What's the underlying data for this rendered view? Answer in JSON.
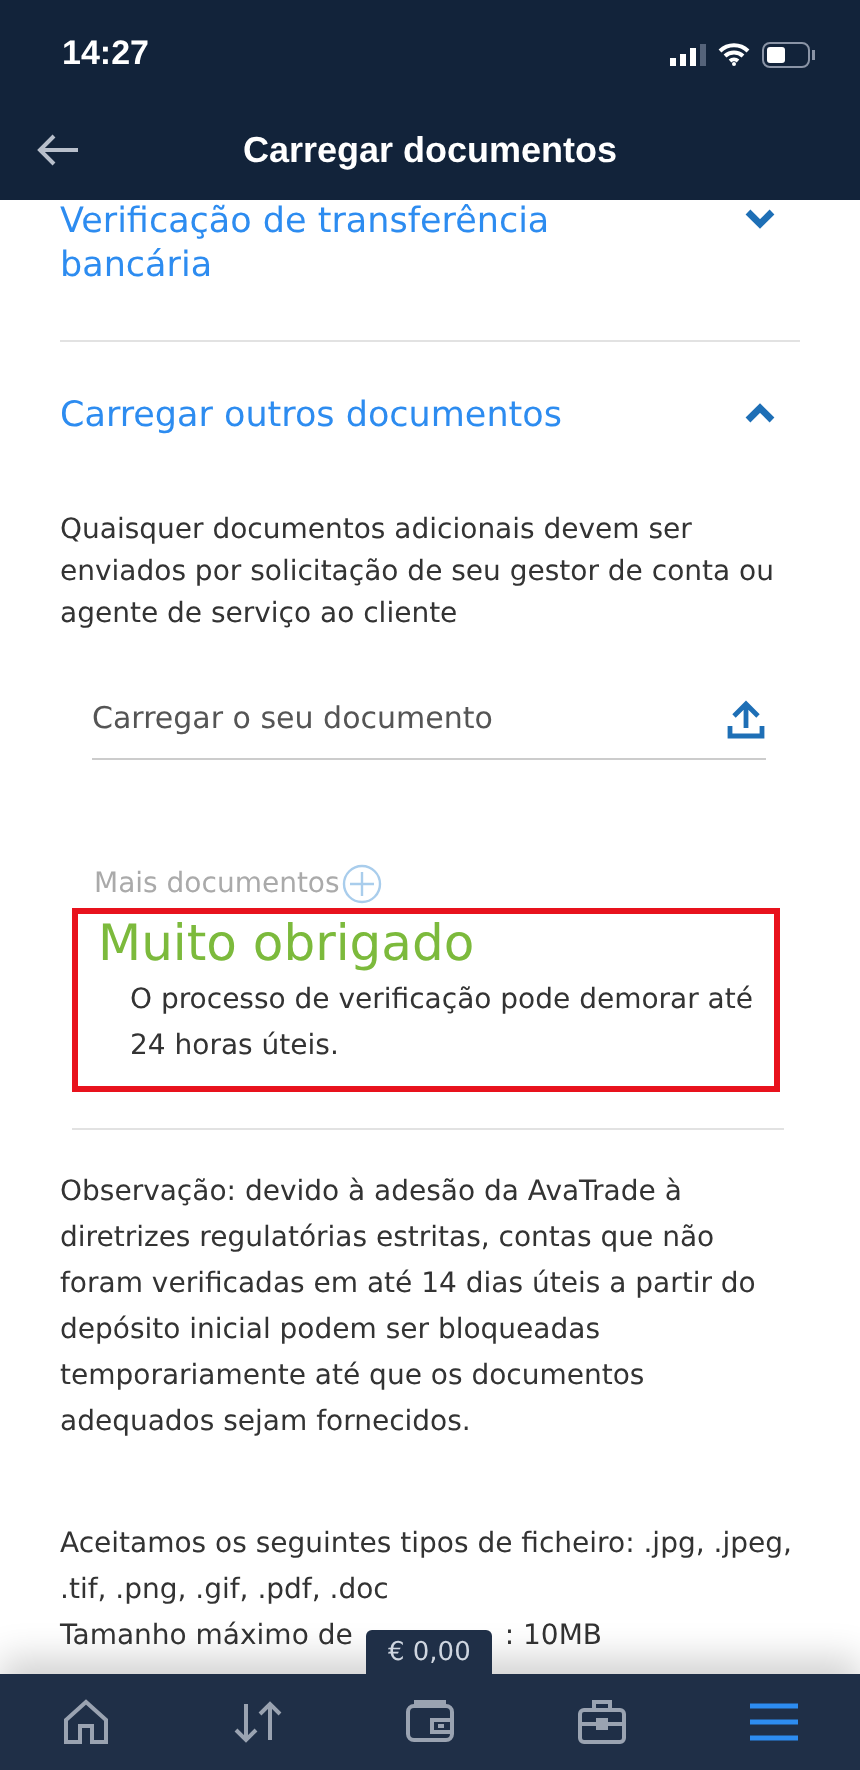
{
  "status_bar": {
    "time": "14:27"
  },
  "header": {
    "title": "Carregar documentos"
  },
  "sections": [
    {
      "title": "Verificação de transferência bancária",
      "expanded": false
    },
    {
      "title": "Carregar outros documentos",
      "expanded": true
    }
  ],
  "intro": "Quaisquer documentos adicionais devem ser enviados por solicitação de seu gestor de conta ou agente de serviço ao cliente",
  "upload_field": {
    "placeholder": "Carregar o seu documento"
  },
  "more_documents": "Mais documentos",
  "thanks": {
    "title": "Muito obrigado",
    "message": "O processo de verificação pode demorar até 24 horas úteis."
  },
  "note": "Observação: devido à adesão da AvaTrade à diretrizes regulatórias estritas, contas que não foram verificadas em até 14 dias úteis a partir do depósito inicial podem ser bloqueadas temporariamente até que os documentos adequados sejam fornecidos.",
  "file_types": "Aceitamos os seguintes tipos de ficheiro: .jpg, .jpeg, .tif, .png, .gif, .pdf, .doc",
  "max_size": {
    "before": "Tamanho máximo de",
    "after": ": 10MB"
  },
  "balance": "€ 0,00",
  "nav": [
    {
      "selected": false
    },
    {
      "selected": false
    },
    {
      "selected": false
    },
    {
      "selected": false
    },
    {
      "selected": true
    }
  ]
}
